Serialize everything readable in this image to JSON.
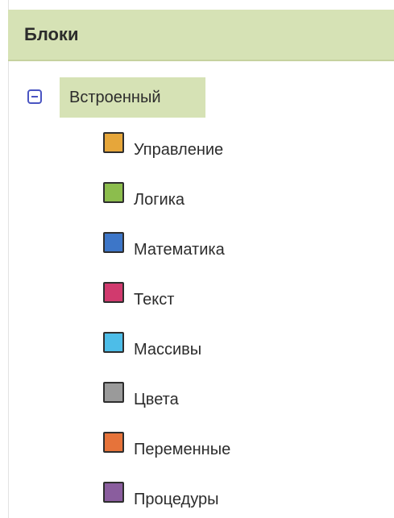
{
  "panel": {
    "title": "Блоки"
  },
  "tree": {
    "root_label": "Встроенный",
    "expanded": true,
    "categories": [
      {
        "label": "Управление",
        "color": "#e6a63a",
        "icon": "control-color-swatch-icon"
      },
      {
        "label": "Логика",
        "color": "#8cbd4d",
        "icon": "logic-color-swatch-icon"
      },
      {
        "label": "Математика",
        "color": "#3d76c8",
        "icon": "math-color-swatch-icon"
      },
      {
        "label": "Текст",
        "color": "#d13a6e",
        "icon": "text-color-swatch-icon"
      },
      {
        "label": "Массивы",
        "color": "#4dbde8",
        "icon": "lists-color-swatch-icon"
      },
      {
        "label": "Цвета",
        "color": "#9a9a9a",
        "icon": "colors-color-swatch-icon"
      },
      {
        "label": "Переменные",
        "color": "#e6733a",
        "icon": "variables-color-swatch-icon"
      },
      {
        "label": "Процедуры",
        "color": "#8a5d9e",
        "icon": "procedures-color-swatch-icon"
      }
    ]
  }
}
